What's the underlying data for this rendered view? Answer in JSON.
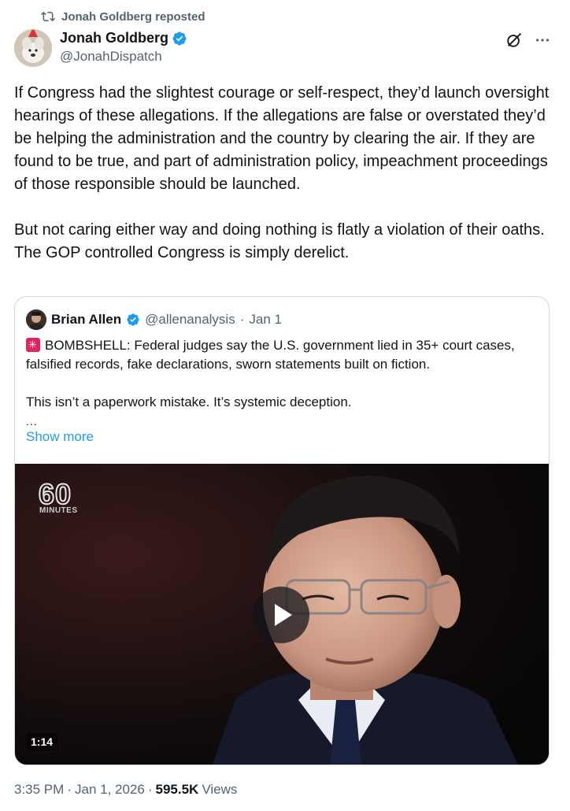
{
  "repost": {
    "label": "Jonah Goldberg reposted"
  },
  "author": {
    "name": "Jonah Goldberg",
    "handle": "@JonahDispatch",
    "verified_color": "#1d9bf0"
  },
  "actions": {
    "grok_icon": "grok-icon",
    "more_icon": "more-icon"
  },
  "tweet": {
    "text": "If Congress had the slightest courage or self-respect, they’d launch oversight hearings of these allegations. If the allegations are false or overstated they’d be helping the administration and the country by clearing the air. If they are found to be true, and part of administration policy, impeachment proceedings of those responsible should be launched.\n\nBut not caring either way and doing nothing is flatly a violation of their oaths. The GOP controlled Congress is simply derelict."
  },
  "quote": {
    "name": "Brian Allen",
    "handle": "@allenanalysis",
    "separator": "·",
    "date": "Jan 1",
    "line1": "BOMBSHELL: Federal judges say the U.S. government lied in 35+ court cases, falsified records, fake declarations, sworn statements built on fiction.",
    "line2": "This isn’t a paperwork mistake. It’s systemic deception.",
    "ellipsis": "...",
    "show_more": "Show more",
    "video": {
      "logo_number": "60",
      "logo_text": "MINUTES",
      "duration": "1:14"
    }
  },
  "meta": {
    "time": "3:35 PM",
    "sep1": "·",
    "date": "Jan 1, 2026",
    "sep2": "·",
    "views_count": "595.5K",
    "views_label": "Views"
  },
  "colors": {
    "accent": "#1d9bf0",
    "text": "#0f1419",
    "muted": "#536471",
    "border": "#cfd9de"
  }
}
